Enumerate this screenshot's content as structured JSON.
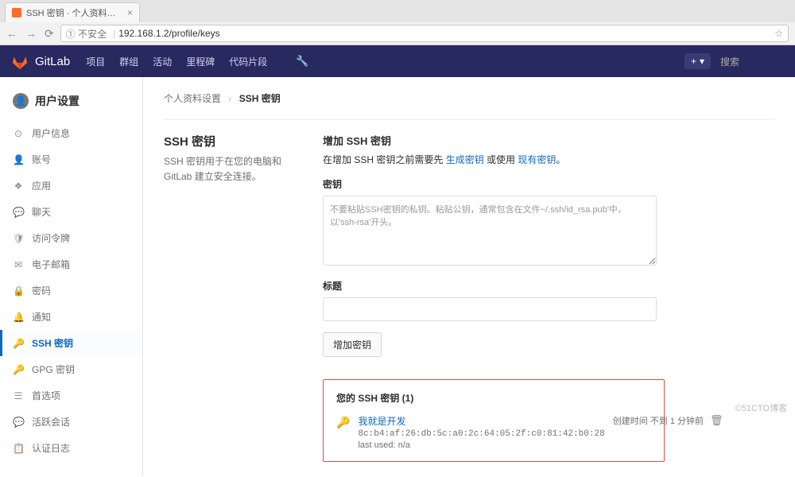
{
  "browser": {
    "tab_title": "SSH 密钥 · 个人资料设置 ×",
    "insecure_label": "① 不安全",
    "url": "192.168.1.2/profile/keys"
  },
  "topnav": {
    "brand": "GitLab",
    "links": {
      "projects": "项目",
      "groups": "群组",
      "activity": "活动",
      "milestones": "里程碑",
      "snippets": "代码片段"
    },
    "plus": "+",
    "caret": "▾",
    "search_placeholder": "搜索"
  },
  "sidebar": {
    "title": "用户设置",
    "items": [
      {
        "icon": "⊙",
        "label": "用户信息"
      },
      {
        "icon": "👤",
        "label": "账号"
      },
      {
        "icon": "❖",
        "label": "应用"
      },
      {
        "icon": "💬",
        "label": "聊天"
      },
      {
        "icon": "🛡",
        "label": "访问令牌"
      },
      {
        "icon": "✉",
        "label": "电子邮箱"
      },
      {
        "icon": "🔒",
        "label": "密码"
      },
      {
        "icon": "🔔",
        "label": "通知"
      },
      {
        "icon": "🔑",
        "label": "SSH 密钥"
      },
      {
        "icon": "🔑",
        "label": "GPG 密钥"
      },
      {
        "icon": "☰",
        "label": "首选项"
      },
      {
        "icon": "💬",
        "label": "活跃会话"
      },
      {
        "icon": "📋",
        "label": "认证日志"
      }
    ]
  },
  "breadcrumb": {
    "parent": "个人资料设置",
    "current": "SSH 密钥"
  },
  "page": {
    "heading": "SSH 密钥",
    "desc": "SSH 密钥用于在您的电脑和 GitLab 建立安全连接。",
    "add_heading": "增加 SSH 密钥",
    "help_prefix": "在增加 SSH 密钥之前需要先 ",
    "help_link1": "生成密钥",
    "help_mid": " 或使用 ",
    "help_link2": "现有密钥",
    "help_suffix": "。",
    "key_label": "密钥",
    "key_placeholder": "不要粘贴SSH密钥的私钥。粘贴公钥，通常包含在文件~/.ssh/id_rsa.pub'中，以'ssh-rsa'开头。",
    "title_label": "标题",
    "add_button": "增加密钥",
    "your_keys": "您的 SSH 密钥 (1)",
    "key": {
      "name": "我就是开发",
      "fingerprint": "8c:b4:af:26:db:5c:a0:2c:64:05:2f:c0:81:42:b0:28",
      "last_used": "last used: n/a",
      "created": "创建时间 不到 1 分钟前"
    }
  },
  "watermark": "©51CTO博客"
}
